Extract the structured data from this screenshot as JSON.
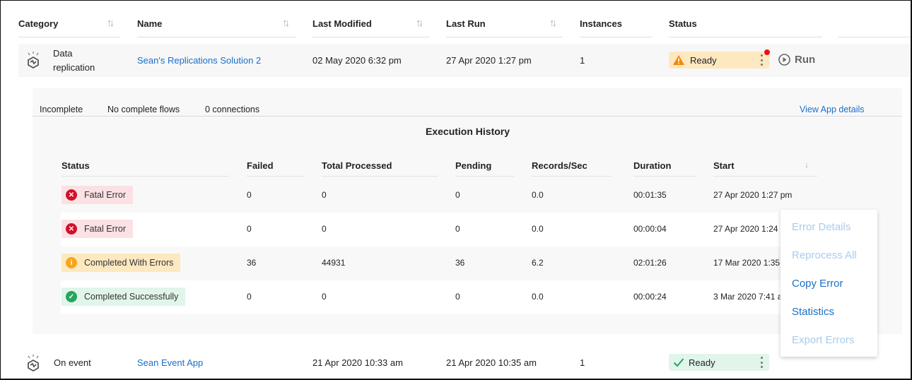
{
  "table": {
    "columns": [
      {
        "label": "Category",
        "sortable": true
      },
      {
        "label": "Name",
        "sortable": true
      },
      {
        "label": "Last Modified",
        "sortable": true
      },
      {
        "label": "Last Run",
        "sortable": true
      },
      {
        "label": "Instances",
        "sortable": false
      },
      {
        "label": "Status",
        "sortable": false
      }
    ],
    "rows": [
      {
        "category_line1": "Data",
        "category_line2": "replication",
        "icon": "cube-app-icon",
        "name": "Sean's Replications Solution 2",
        "last_modified": "02 May 2020 6:32 pm",
        "last_run": "27 Apr 2020 1:27 pm",
        "instances": "1",
        "status": "Ready",
        "status_icon": "warning-triangle-icon",
        "status_color": "#fde8c0",
        "has_notification": true,
        "run_label": "Run"
      },
      {
        "category": "On event",
        "icon": "cube-app-icon",
        "name": "Sean Event App",
        "last_modified": "21 Apr 2020 10:33 am",
        "last_run": "21 Apr 2020 10:35 am",
        "instances": "1",
        "status": "Ready",
        "status_icon": "checkmark-icon",
        "status_color": "#e1f5ea"
      }
    ]
  },
  "detail": {
    "summary": [
      "Incomplete",
      "No complete flows",
      "0 connections"
    ],
    "view_link": "View App details",
    "title": "Execution History",
    "columns": [
      "Status",
      "Failed",
      "Total Processed",
      "Pending",
      "Records/Sec",
      "Duration",
      "Start"
    ],
    "sort_indicator": "↓",
    "rows": [
      {
        "status": "Fatal Error",
        "type": "error",
        "failed": "0",
        "total": "0",
        "pending": "0",
        "rps": "0.0",
        "duration": "00:01:35",
        "start": "27 Apr 2020 1:27 pm"
      },
      {
        "status": "Fatal Error",
        "type": "error",
        "failed": "0",
        "total": "0",
        "pending": "0",
        "rps": "0.0",
        "duration": "00:00:04",
        "start": "27 Apr 2020 1:24"
      },
      {
        "status": "Completed With Errors",
        "type": "warning",
        "failed": "36",
        "total": "44931",
        "pending": "36",
        "rps": "6.2",
        "duration": "02:01:26",
        "start": "17 Mar 2020 1:35"
      },
      {
        "status": "Completed Successfully",
        "type": "success",
        "failed": "0",
        "total": "0",
        "pending": "0",
        "rps": "0.0",
        "duration": "00:00:24",
        "start": "3 Mar 2020 7:41 a"
      }
    ]
  },
  "context_menu": {
    "items": [
      {
        "label": "Error Details",
        "enabled": false
      },
      {
        "label": "Reprocess All",
        "enabled": false
      },
      {
        "label": "Copy Error",
        "enabled": true
      },
      {
        "label": "Statistics",
        "enabled": true
      },
      {
        "label": "Export Errors",
        "enabled": false
      }
    ]
  },
  "colors": {
    "link": "#1a6fc9",
    "error_bg": "#fbe1e4",
    "error_icon": "#d0112b",
    "warning_bg": "#fde8c0",
    "warning_icon": "#f8a51c",
    "success_bg": "#e1f5ea",
    "success_icon": "#25a55f",
    "notification_dot": "#ee1111"
  }
}
